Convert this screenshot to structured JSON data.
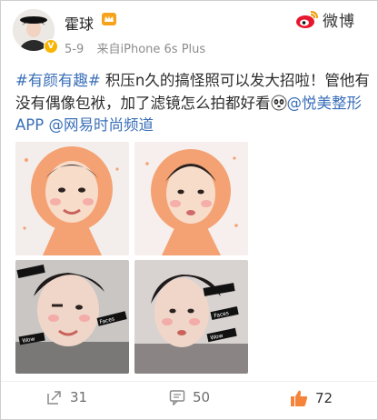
{
  "post": {
    "username": "霍球",
    "date": "5-9",
    "source": "来自iPhone 6s Plus",
    "brand": "微博",
    "text_segments": [
      {
        "text": "#有颜有趣#",
        "link": true
      },
      {
        "text": " 积压n久的搞怪照可以发大招啦！管他有没有偶像包袱，加了滤镜怎么拍都好看",
        "link": false
      },
      {
        "text": "@悦美整形APP",
        "link": true
      },
      {
        "text": " ",
        "link": false
      },
      {
        "text": "@网易时尚频道",
        "link": true
      }
    ],
    "photo_stickers": [
      "Faces",
      "Wow"
    ]
  },
  "actions": {
    "repost_count": "31",
    "comment_count": "50",
    "like_count": "72"
  },
  "colors": {
    "link": "#3a6fb8",
    "brand_red": "#e6162d",
    "like_orange": "#f5843a",
    "filter_orange": "#f4a273"
  }
}
